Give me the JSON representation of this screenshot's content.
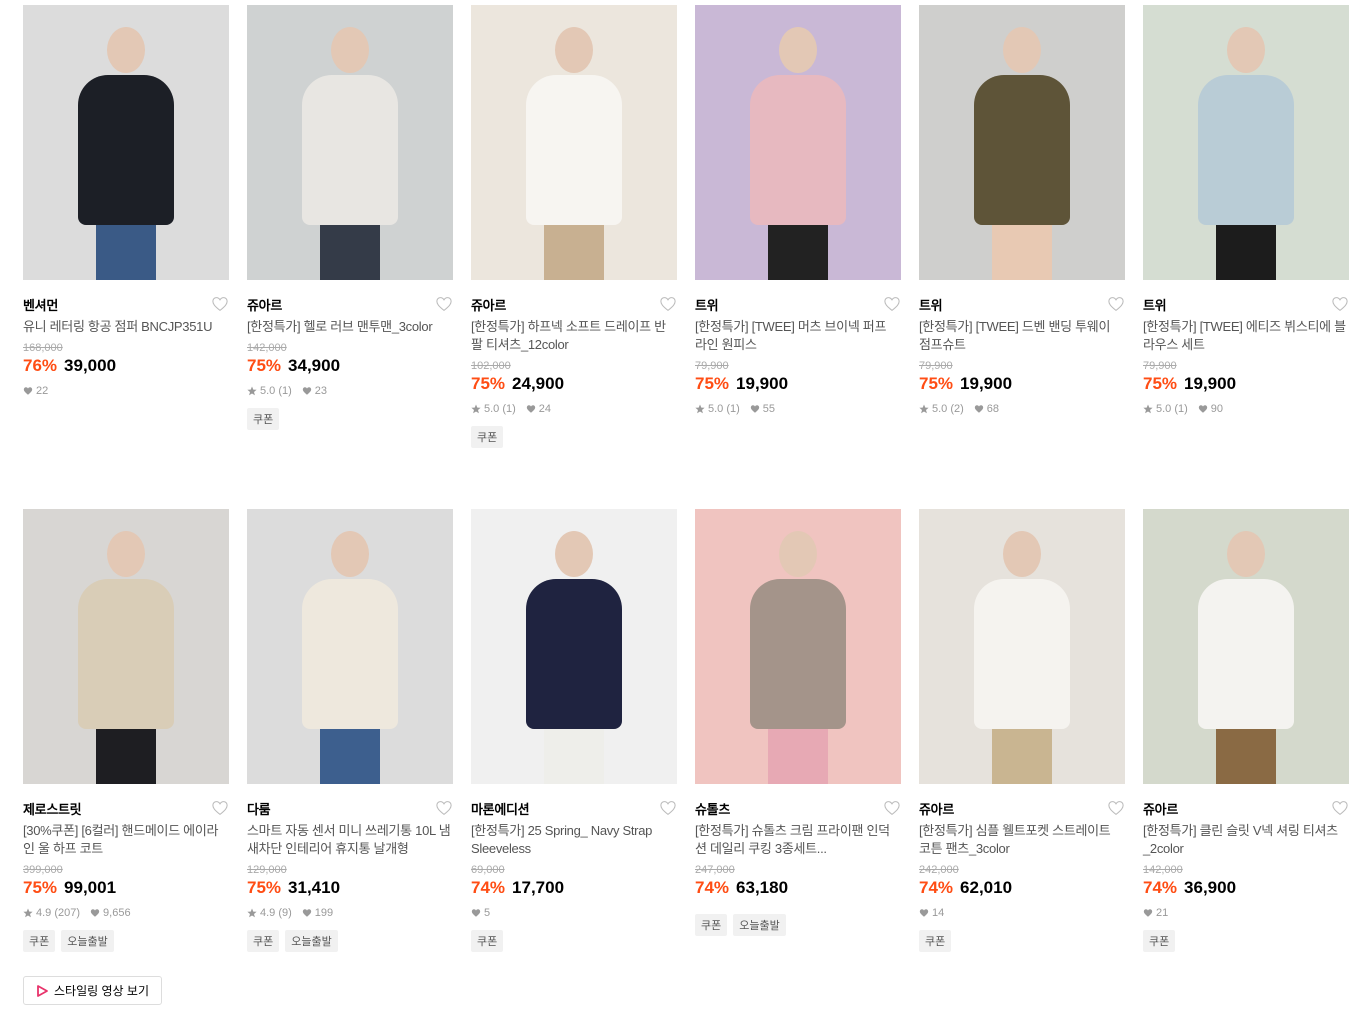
{
  "products": [
    {
      "brand": "벤셔먼",
      "name": "유니 레터링 항공 점퍼 BNCJP351U",
      "original": "168,000",
      "discount": "76%",
      "price": "39,000",
      "rating": "",
      "likes": "22",
      "tags": [],
      "bg": "#dcdcdc",
      "color": "#1c1f26",
      "legs": "#3a5a86"
    },
    {
      "brand": "쥬아르",
      "name": "[한정특가] 헬로 러브 맨투맨_3color",
      "original": "142,000",
      "discount": "75%",
      "price": "34,900",
      "rating": "5.0 (1)",
      "likes": "23",
      "tags": [
        "쿠폰"
      ],
      "bg": "#cfd2d2",
      "color": "#e8e6e2",
      "legs": "#343b48"
    },
    {
      "brand": "쥬아르",
      "name": "[한정특가] 하프넥 소프트 드레이프 반팔 티셔츠_12color",
      "original": "102,000",
      "discount": "75%",
      "price": "24,900",
      "rating": "5.0 (1)",
      "likes": "24",
      "tags": [
        "쿠폰"
      ],
      "bg": "#ece6dd",
      "color": "#f7f5f1",
      "legs": "#c8b091"
    },
    {
      "brand": "트위",
      "name": "[한정특가] [TWEE] 머츠 브이넥 퍼프 라인 원피스",
      "original": "79,900",
      "discount": "75%",
      "price": "19,900",
      "rating": "5.0 (1)",
      "likes": "55",
      "tags": [],
      "bg": "#c9b8d6",
      "color": "#e7b9c0",
      "legs": "#222222"
    },
    {
      "brand": "트위",
      "name": "[한정특가] [TWEE] 드벤 밴딩 투웨이 점프슈트",
      "original": "79,900",
      "discount": "75%",
      "price": "19,900",
      "rating": "5.0 (2)",
      "likes": "68",
      "tags": [],
      "bg": "#cfcfcd",
      "color": "#5e5438",
      "legs": "#e8c9b3"
    },
    {
      "brand": "트위",
      "name": "[한정특가] [TWEE] 에티즈 뷔스티에 블라우스 세트",
      "original": "79,900",
      "discount": "75%",
      "price": "19,900",
      "rating": "5.0 (1)",
      "likes": "90",
      "tags": [],
      "bg": "#d5ddd2",
      "color": "#b9ccd6",
      "legs": "#1c1c1c"
    },
    {
      "brand": "제로스트릿",
      "name": "[30%쿠폰] [6컬러] 핸드메이드 에이라인 울 하프 코트",
      "original": "399,000",
      "discount": "75%",
      "price": "99,001",
      "rating": "4.9 (207)",
      "likes": "9,656",
      "tags": [
        "쿠폰",
        "오늘출발"
      ],
      "bg": "#d8d6d3",
      "color": "#d9cdb7",
      "legs": "#1e1e22"
    },
    {
      "brand": "다룸",
      "name": "스마트 자동 센서 미니 쓰레기통 10L 냄새차단 인테리어 휴지통 날개형",
      "original": "129,000",
      "discount": "75%",
      "price": "31,410",
      "rating": "4.9 (9)",
      "likes": "199",
      "tags": [
        "쿠폰",
        "오늘출발"
      ],
      "bg": "#dcdcdc",
      "color": "#eee8dd",
      "legs": "#3d5f8e"
    },
    {
      "brand": "마론에디션",
      "name": "[한정특가] 25 Spring_ Navy Strap Sleeveless",
      "original": "69,000",
      "discount": "74%",
      "price": "17,700",
      "rating": "",
      "likes": "5",
      "tags": [
        "쿠폰"
      ],
      "bg": "#f0f0f0",
      "color": "#1f2340",
      "legs": "#eeeeea"
    },
    {
      "brand": "슈톨츠",
      "name": "[한정특가] 슈톨츠 크림 프라이팬 인덕션 데일리 쿠킹 3종세트...",
      "original": "247,000",
      "discount": "74%",
      "price": "63,180",
      "rating": "",
      "likes": "",
      "tags": [
        "쿠폰",
        "오늘출발"
      ],
      "bg": "#f0c4c0",
      "color": "#a4948a",
      "legs": "#e7a9b4"
    },
    {
      "brand": "쥬아르",
      "name": "[한정특가] 심플 웰트포켓 스트레이트 코튼 팬츠_3color",
      "original": "242,000",
      "discount": "74%",
      "price": "62,010",
      "rating": "",
      "likes": "14",
      "tags": [
        "쿠폰"
      ],
      "bg": "#e6e2dc",
      "color": "#f5f3ef",
      "legs": "#c9b591"
    },
    {
      "brand": "쥬아르",
      "name": "[한정특가] 클린 슬릿 V넥 셔링 티셔츠_2color",
      "original": "142,000",
      "discount": "74%",
      "price": "36,900",
      "rating": "",
      "likes": "21",
      "tags": [
        "쿠폰"
      ],
      "bg": "#d4d9cc",
      "color": "#f4f3f0",
      "legs": "#8a6a44"
    }
  ],
  "video_button": {
    "label": "스타일링 영상 보기"
  }
}
